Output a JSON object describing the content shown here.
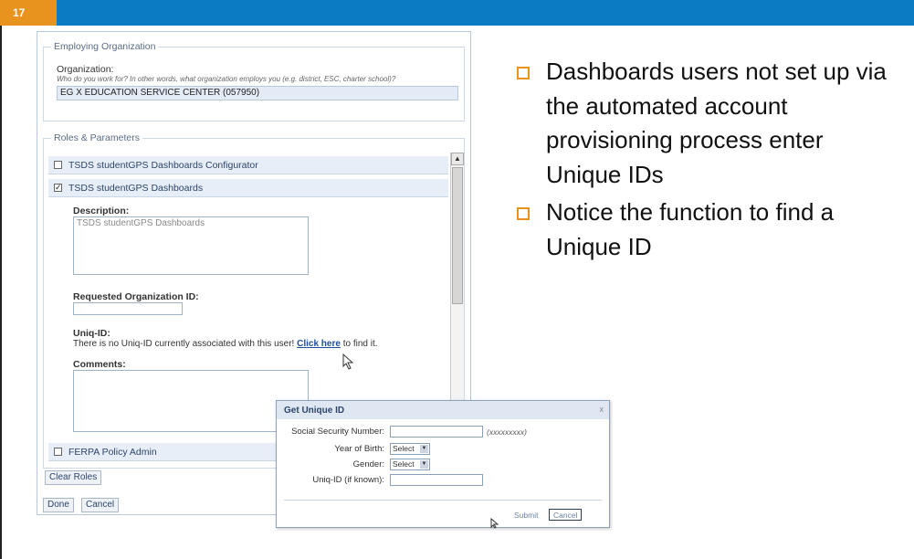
{
  "slide": {
    "number": "17"
  },
  "employing_org": {
    "legend": "Employing Organization",
    "org_label": "Organization:",
    "org_hint": "Who do you work for? In other words, what organization employs you (e.g. district, ESC, charter school)?",
    "org_value": "EG X EDUCATION SERVICE CENTER (057950)"
  },
  "roles": {
    "legend": "Roles & Parameters",
    "items": [
      {
        "label": "TSDS studentGPS Dashboards Configurator",
        "checked": ""
      },
      {
        "label": "TSDS studentGPS Dashboards",
        "checked": "✓"
      },
      {
        "label": "FERPA Policy Admin",
        "checked": ""
      }
    ],
    "description_label": "Description:",
    "description_value": "TSDS studentGPS Dashboards",
    "requested_org_label": "Requested Organization ID:",
    "uniq_label": "Uniq-ID:",
    "uniq_text_before": "There is no Uniq-ID currently associated with this user!",
    "uniq_link": "Click here",
    "uniq_text_after": "to find it.",
    "comments_label": "Comments:"
  },
  "buttons": {
    "clear_roles": "Clear Roles",
    "done": "Done",
    "cancel": "Cancel"
  },
  "modal": {
    "title": "Get Unique ID",
    "close": "x",
    "ssn_label": "Social Security Number:",
    "ssn_format": "(xxxxxxxxx)",
    "yob_label": "Year of Birth:",
    "yob_value": "Select",
    "gender_label": "Gender:",
    "gender_value": "Select",
    "uniq_label": "Uniq-ID (if known):",
    "submit": "Submit",
    "cancel": "Cancel"
  },
  "bullets": [
    "Dashboards users not set up via the automated account provisioning process enter Unique IDs",
    "Notice the function to find a Unique ID"
  ],
  "colors": {
    "header": "#0b7bc4",
    "accent": "#e8931e"
  }
}
